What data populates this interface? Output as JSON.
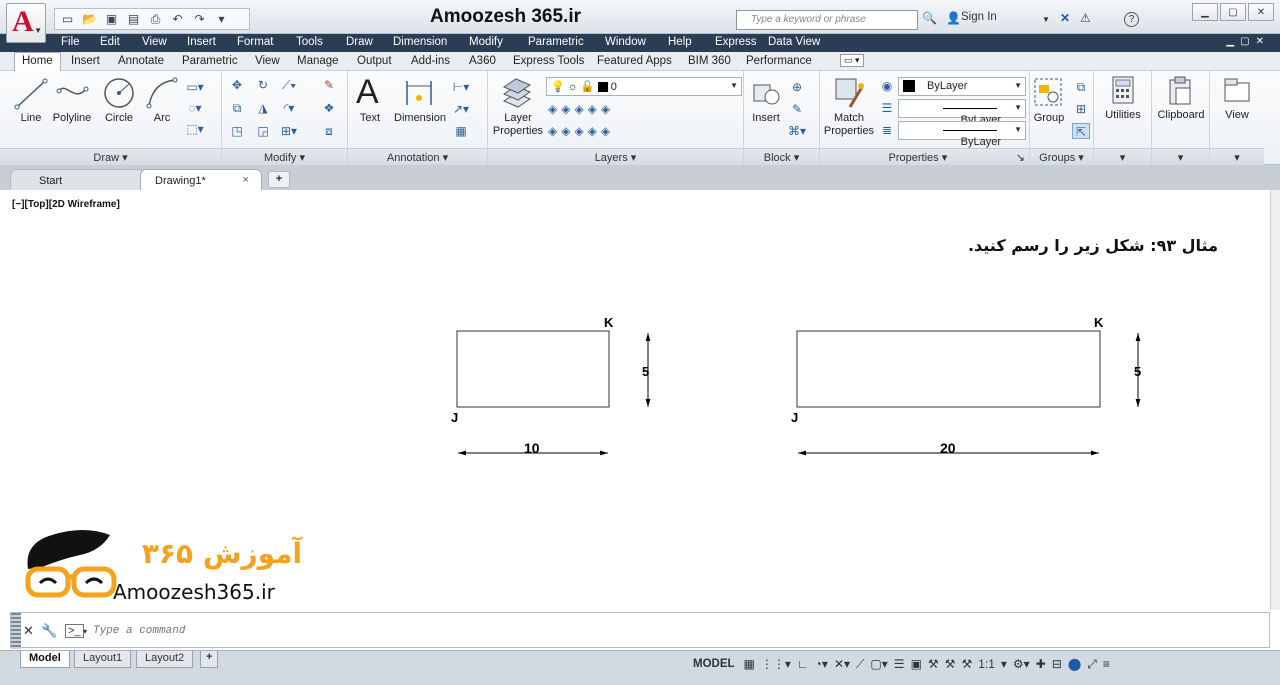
{
  "titlebar": {
    "app_title": "Amoozesh 365.ir",
    "search_placeholder": "Type a keyword or phrase",
    "sign_in": "Sign In",
    "help": "?",
    "qat_icons": [
      "new-icon",
      "open-icon",
      "save-icon",
      "save-as-icon",
      "print-icon",
      "undo-icon",
      "redo-icon",
      "workspace-dropdown-icon"
    ]
  },
  "menu": [
    "File",
    "Edit",
    "View",
    "Insert",
    "Format",
    "Tools",
    "Draw",
    "Dimension",
    "Modify",
    "Parametric",
    "Window",
    "Help",
    "Express",
    "Data View"
  ],
  "ribbon_tabs": [
    "Home",
    "Insert",
    "Annotate",
    "Parametric",
    "View",
    "Manage",
    "Output",
    "Add-ins",
    "A360",
    "Express Tools",
    "Featured Apps",
    "BIM 360",
    "Performance"
  ],
  "ribbon": {
    "draw": {
      "title": "Draw",
      "line": "Line",
      "polyline": "Polyline",
      "circle": "Circle",
      "arc": "Arc"
    },
    "modify": {
      "title": "Modify"
    },
    "annotation": {
      "title": "Annotation",
      "text": "Text",
      "text_glyph": "A",
      "dimension": "Dimension"
    },
    "layers": {
      "title": "Layers",
      "layer_properties": "Layer Properties",
      "layer_value": "0"
    },
    "block": {
      "title": "Block",
      "insert": "Insert"
    },
    "properties": {
      "title": "Properties",
      "match_properties": "Match Properties",
      "color": "ByLayer",
      "linetype": "ByLayer",
      "lineweight": "ByLayer"
    },
    "groups": {
      "title": "Groups",
      "group": "Group"
    },
    "utilities": {
      "title": "Utilities"
    },
    "clipboard": {
      "title": "Clipboard"
    },
    "view": {
      "title": "View"
    }
  },
  "doc_tabs": {
    "start": "Start",
    "drawing": "Drawing1*",
    "close": "×",
    "add": "+"
  },
  "canvas": {
    "viewport_label": "[−][Top][2D Wireframe]",
    "instruction": "مثال ۹۳: شکل زیر را رسم کنید.",
    "figure1": {
      "corner_top": "K",
      "corner_bottom": "J",
      "height": "5",
      "width": "10"
    },
    "figure2": {
      "corner_top": "K",
      "corner_bottom": "J",
      "height": "5",
      "width": "20"
    },
    "logo_persian": "آموزش ۳۶۵",
    "logo_site": "Amoozesh365.ir"
  },
  "command": {
    "placeholder": "Type a command"
  },
  "layout_tabs": [
    "Model",
    "Layout1",
    "Layout2"
  ],
  "status": {
    "model": "MODEL",
    "scale": "1:1",
    "icons": [
      "grid-icon",
      "snap-icon",
      "ortho-icon",
      "polar-icon",
      "osnap-icon",
      "isometric-icon",
      "annotation-scale-icon",
      "settings-icon",
      "plus-icon",
      "monitor-icon",
      "hardware-accel-icon",
      "fullscreen-icon",
      "menu-icon"
    ]
  },
  "colors": {
    "menubar": "#2b3d55",
    "accent": "#c8102e",
    "logo_orange": "#f6a21d"
  }
}
